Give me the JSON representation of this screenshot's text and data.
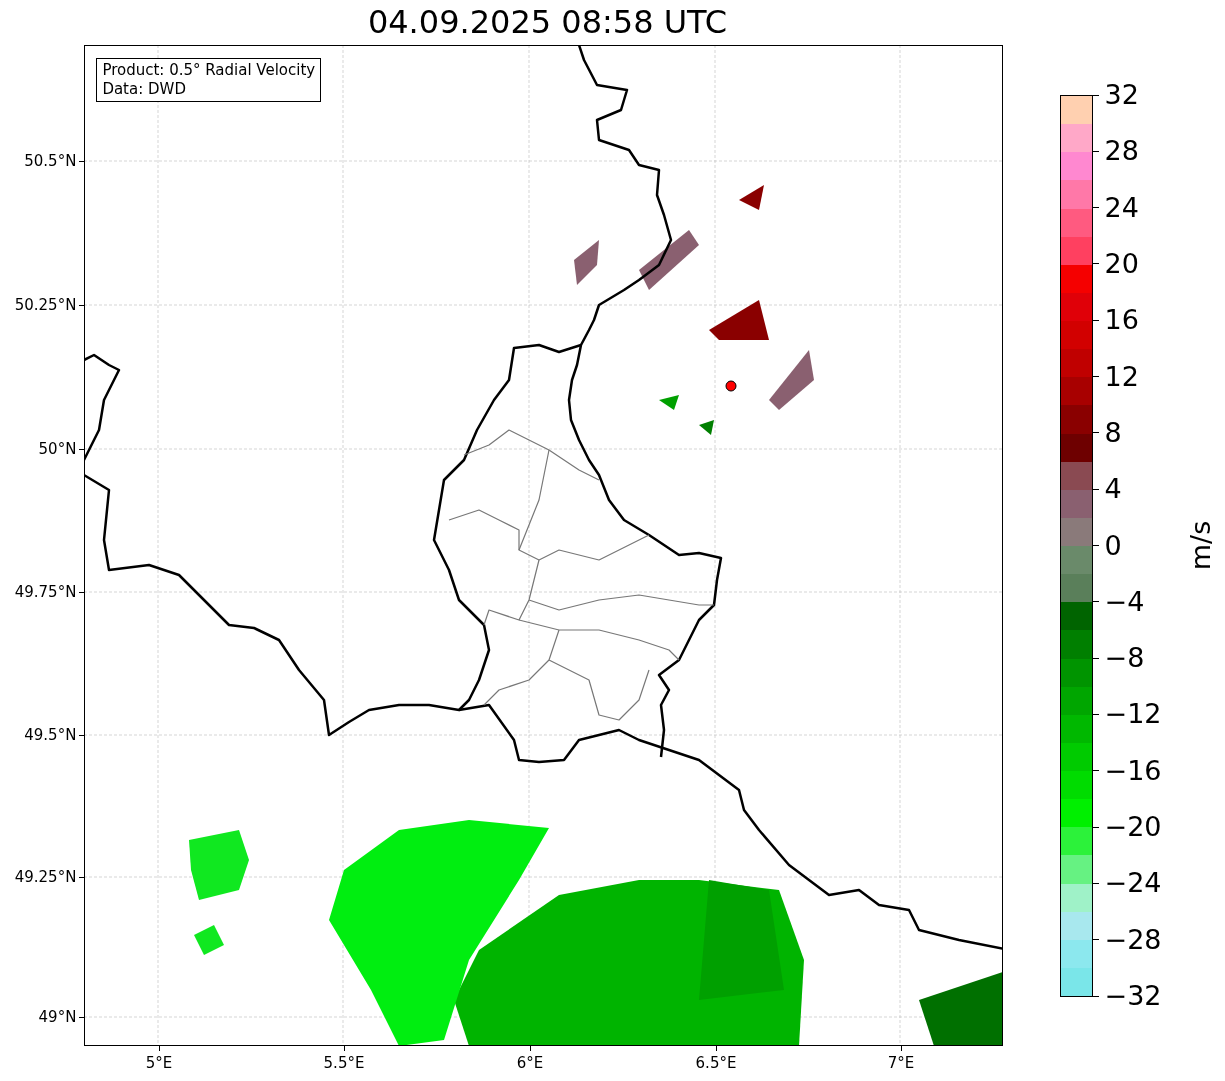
{
  "title": "04.09.2025 08:58 UTC",
  "legend": [
    "Product: 0.5° Radial Velocity",
    "Data: DWD"
  ],
  "x_ticks": [
    "5°E",
    "5.5°E",
    "6°E",
    "6.5°E",
    "7°E"
  ],
  "y_ticks": [
    "50.5°N",
    "50.25°N",
    "50°N",
    "49.75°N",
    "49.5°N",
    "49.25°N",
    "49°N"
  ],
  "colorbar": {
    "label": "m/s",
    "ticks": [
      "32",
      "28",
      "24",
      "20",
      "16",
      "12",
      "8",
      "4",
      "0",
      "−4",
      "−8",
      "−12",
      "−16",
      "−20",
      "−24",
      "−28",
      "−32"
    ],
    "bins": [
      {
        "color": "#ffd0b0"
      },
      {
        "color": "#ffa8c8"
      },
      {
        "color": "#ff88d0"
      },
      {
        "color": "#ff78a8"
      },
      {
        "color": "#ff5a80"
      },
      {
        "color": "#ff4060"
      },
      {
        "color": "#f50000"
      },
      {
        "color": "#e00008"
      },
      {
        "color": "#d20000"
      },
      {
        "color": "#c00000"
      },
      {
        "color": "#a80000"
      },
      {
        "color": "#8a0000"
      },
      {
        "color": "#6e0000"
      },
      {
        "color": "#8a4a52"
      },
      {
        "color": "#8a6070"
      },
      {
        "color": "#8a7a7a"
      },
      {
        "color": "#6a8a6a"
      },
      {
        "color": "#5a7f5a"
      },
      {
        "color": "#006400"
      },
      {
        "color": "#007f00"
      },
      {
        "color": "#009400"
      },
      {
        "color": "#00a600"
      },
      {
        "color": "#00b800"
      },
      {
        "color": "#00cb00"
      },
      {
        "color": "#00dc00"
      },
      {
        "color": "#00f000"
      },
      {
        "color": "#2cf23a"
      },
      {
        "color": "#66f282"
      },
      {
        "color": "#9ff2c8"
      },
      {
        "color": "#a8e8ee"
      },
      {
        "color": "#8ce8ee"
      },
      {
        "color": "#7ae6e9"
      }
    ]
  }
}
